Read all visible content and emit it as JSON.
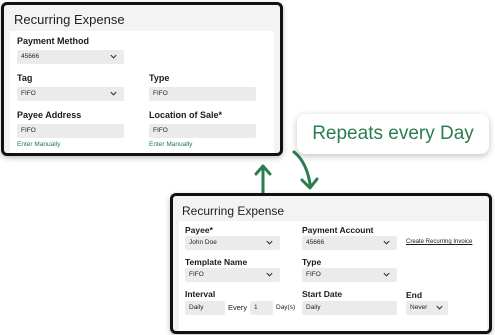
{
  "colors": {
    "accent": "#2b7d4f",
    "link": "#1f7a4a"
  },
  "top_card": {
    "title": "Recurring Expense",
    "payment_method": {
      "label": "Payment Method",
      "value": "45666"
    },
    "tag": {
      "label": "Tag",
      "value": "FIFO"
    },
    "type": {
      "label": "Type",
      "value": "FIFO"
    },
    "payee_address": {
      "label": "Payee Address",
      "value": "FIFO",
      "link": "Enter Manually"
    },
    "location_of_sale": {
      "label": "Location of Sale*",
      "value": "FIFO",
      "link": "Enter Manually"
    }
  },
  "callout": {
    "text": "Repeats every Day"
  },
  "arrows": {
    "icon": "cycle-arrows-icon"
  },
  "bottom_card": {
    "title": "Recurring Expense",
    "payee": {
      "label": "Payee*",
      "value": "John Doe"
    },
    "payment_account": {
      "label": "Payment Account",
      "value": "45666",
      "link": "Create Recurring Invoice"
    },
    "template_name": {
      "label": "Template Name",
      "value": "FIFO"
    },
    "type": {
      "label": "Type",
      "value": "FIFO"
    },
    "interval": {
      "label": "Interval",
      "value": "Daily",
      "every_label": "Every",
      "every_value": "1",
      "unit_label": "Day(s)"
    },
    "start_date": {
      "label": "Start Date",
      "value": "Daily"
    },
    "end": {
      "label": "End",
      "value": "Never"
    }
  }
}
